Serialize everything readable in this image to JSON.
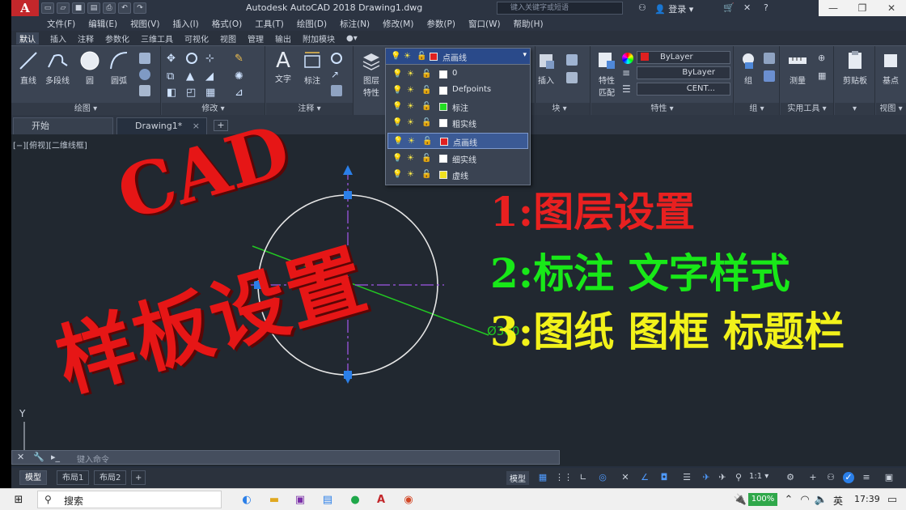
{
  "window": {
    "app_logo": "A",
    "title": "Autodesk AutoCAD 2018   Drawing1.dwg",
    "search_placeholder": "键入关键字或短语",
    "login": "登录",
    "controls": [
      "—",
      "❐",
      "✕"
    ]
  },
  "menubar": [
    "文件(F)",
    "编辑(E)",
    "视图(V)",
    "插入(I)",
    "格式(O)",
    "工具(T)",
    "绘图(D)",
    "标注(N)",
    "修改(M)",
    "参数(P)",
    "窗口(W)",
    "帮助(H)"
  ],
  "ribbon_tabs": [
    "默认",
    "插入",
    "注释",
    "参数化",
    "三维工具",
    "可视化",
    "视图",
    "管理",
    "输出",
    "附加模块",
    "●▾"
  ],
  "ribbon": {
    "draw": {
      "title": "绘图 ▾",
      "tools": [
        "直线",
        "多段线",
        "圆",
        "圆弧"
      ]
    },
    "modify": {
      "title": "修改 ▾"
    },
    "annotation": {
      "title": "注释 ▾",
      "tools": [
        "文字",
        "标注"
      ],
      "text_glyph": "A"
    },
    "layers": {
      "tool": "图层\n特性",
      "tool_a": "图层",
      "tool_b": "特性"
    },
    "block": {
      "title": "块 ▾",
      "insert": "插入"
    },
    "properties": {
      "title": "特性 ▾",
      "match_a": "特性",
      "match_b": "匹配",
      "color": "ByLayer",
      "linetype": "ByLayer",
      "lineweight": "CENT...",
      "color_value": "#e02020"
    },
    "groups": {
      "title": "组 ▾",
      "tool": "组"
    },
    "utilities": {
      "title": "实用工具 ▾",
      "tool": "测量"
    },
    "clipboard": {
      "title": "▾",
      "tool": "剪贴板"
    },
    "view": {
      "title": "视图 ▾",
      "tool": "基点"
    }
  },
  "layer_dropdown": {
    "current": "点画线",
    "items": [
      {
        "name": "0",
        "color": "#ffffff"
      },
      {
        "name": "Defpoints",
        "color": "#ffffff"
      },
      {
        "name": "标注",
        "color": "#22dd22"
      },
      {
        "name": "粗实线",
        "color": "#ffffff"
      },
      {
        "name": "点画线",
        "color": "#e02020",
        "selected": true
      },
      {
        "name": "细实线",
        "color": "#ffffff"
      },
      {
        "name": "虚线",
        "color": "#f0e020"
      }
    ]
  },
  "doc_tabs": {
    "start": "开始",
    "drawing": "Drawing1*",
    "close": "×",
    "add": "+"
  },
  "canvas": {
    "view_label": "[−][俯视][二维线框]",
    "dimension_text": "Ø300",
    "ucs_y": "Y"
  },
  "overlay": {
    "cad": "CAD",
    "template": "样板设置",
    "items": [
      {
        "num": "1:",
        "text": "图层设置",
        "color": "#e82020"
      },
      {
        "num": "2:",
        "text": "标注 文字样式",
        "color": "#18e818"
      },
      {
        "num": "3:",
        "text": "图纸 图框 标题栏",
        "color": "#f2f21a"
      }
    ]
  },
  "command_line": {
    "placeholder": "键入命令"
  },
  "statusbar": {
    "layout_tabs": [
      "模型",
      "布局1",
      "布局2",
      "+"
    ],
    "model_label": "模型",
    "scale": "1:1 ▾"
  },
  "taskbar": {
    "search": "搜索",
    "battery": "100%",
    "ime": "英",
    "time": "17:39"
  }
}
